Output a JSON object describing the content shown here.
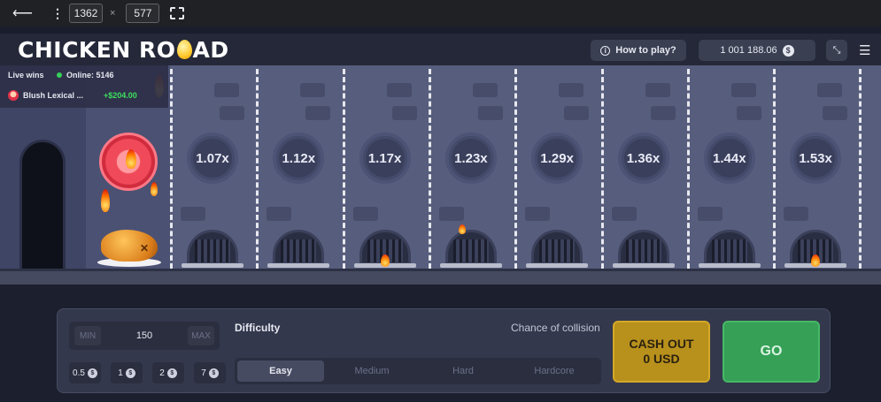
{
  "devtools": {
    "width": "1362",
    "times": "×",
    "height": "577"
  },
  "header": {
    "logo_left": "CHICKEN RO",
    "logo_right": "AD",
    "how_to_play": "How to play?",
    "balance": "1 001 188.06",
    "currency_symbol": "$"
  },
  "live": {
    "title": "Live wins",
    "online": "Online: 5146",
    "player": "Blush Lexical ...",
    "amount": "+$204.00"
  },
  "lanes": [
    {
      "multiplier": "1.07x",
      "fire": false
    },
    {
      "multiplier": "1.12x",
      "fire": false
    },
    {
      "multiplier": "1.17x",
      "fire": true
    },
    {
      "multiplier": "1.23x",
      "fire": false
    },
    {
      "multiplier": "1.29x",
      "fire": false
    },
    {
      "multiplier": "1.36x",
      "fire": false
    },
    {
      "multiplier": "1.44x",
      "fire": false
    },
    {
      "multiplier": "1.53x",
      "fire": true
    }
  ],
  "panel": {
    "min_label": "MIN",
    "bet_value": "150",
    "max_label": "MAX",
    "chips": [
      "0.5",
      "1",
      "2",
      "7"
    ],
    "difficulty_label": "Difficulty",
    "collision_label": "Chance of collision",
    "difficulties": [
      "Easy",
      "Medium",
      "Hard",
      "Hardcore"
    ],
    "active_difficulty": "Easy",
    "cashout_line1": "CASH OUT",
    "cashout_line2": "0 USD",
    "go_label": "GO"
  },
  "colors": {
    "cashout": "#b8901c",
    "go": "#35a056",
    "win_amount": "#3ce05f",
    "danger_coin": "#f04a5a"
  }
}
